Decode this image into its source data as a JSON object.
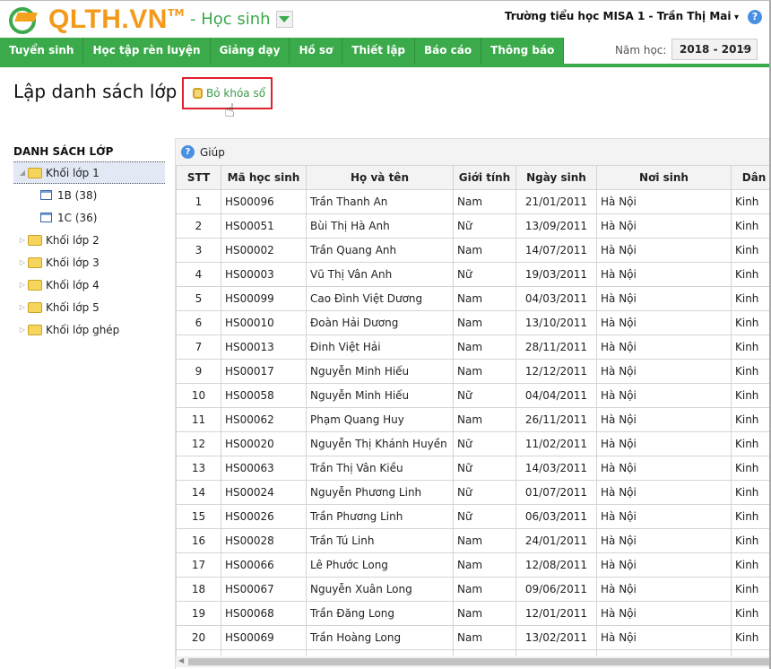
{
  "header": {
    "logo": "QLTH.VN",
    "trademark": "TM",
    "module": "- Học sinh",
    "user": "Trường tiểu học MISA 1 - Trần Thị Mai",
    "help_icon": "?"
  },
  "nav": [
    "Tuyển sinh",
    "Học tập rèn luyện",
    "Giảng dạy",
    "Hồ sơ",
    "Thiết lập",
    "Báo cáo",
    "Thông báo"
  ],
  "year": {
    "label": "Năm học:",
    "value": "2018 - 2019"
  },
  "page": {
    "title": "Lập danh sách lớp",
    "unlock_button": "Bỏ khóa sổ"
  },
  "tree": {
    "title": "DANH SÁCH LỚP",
    "items": [
      {
        "label": "Khối lớp 1",
        "type": "folder",
        "expanded": true,
        "selected": true,
        "level": 0
      },
      {
        "label": "1B (38)",
        "type": "class",
        "level": 1
      },
      {
        "label": "1C (36)",
        "type": "class",
        "level": 1
      },
      {
        "label": "Khối lớp 2",
        "type": "folder",
        "level": 0
      },
      {
        "label": "Khối lớp 3",
        "type": "folder",
        "level": 0
      },
      {
        "label": "Khối lớp 4",
        "type": "folder",
        "level": 0
      },
      {
        "label": "Khối lớp 5",
        "type": "folder",
        "level": 0
      },
      {
        "label": "Khối lớp ghép",
        "type": "folder",
        "level": 0
      }
    ]
  },
  "toolbar": {
    "help": "Giúp"
  },
  "table": {
    "columns": [
      "STT",
      "Mã học sinh",
      "Họ và tên",
      "Giới tính",
      "Ngày sinh",
      "Nơi sinh",
      "Dân t"
    ],
    "rows": [
      [
        "1",
        "HS00096",
        "Trần Thanh An",
        "Nam",
        "21/01/2011",
        "Hà Nội",
        "Kinh"
      ],
      [
        "2",
        "HS00051",
        "Bùi Thị Hà Anh",
        "Nữ",
        "13/09/2011",
        "Hà Nội",
        "Kinh"
      ],
      [
        "3",
        "HS00002",
        "Trần Quang Anh",
        "Nam",
        "14/07/2011",
        "Hà Nội",
        "Kinh"
      ],
      [
        "4",
        "HS00003",
        "Vũ Thị Vân Anh",
        "Nữ",
        "19/03/2011",
        "Hà Nội",
        "Kinh"
      ],
      [
        "5",
        "HS00099",
        "Cao Đình Việt Dương",
        "Nam",
        "04/03/2011",
        "Hà Nội",
        "Kinh"
      ],
      [
        "6",
        "HS00010",
        "Đoàn Hải Dương",
        "Nam",
        "13/10/2011",
        "Hà Nội",
        "Kinh"
      ],
      [
        "7",
        "HS00013",
        "Đinh Việt Hải",
        "Nam",
        "28/11/2011",
        "Hà Nội",
        "Kinh"
      ],
      [
        "9",
        "HS00017",
        "Nguyễn Minh Hiếu",
        "Nam",
        "12/12/2011",
        "Hà Nội",
        "Kinh"
      ],
      [
        "10",
        "HS00058",
        "Nguyễn Minh Hiếu",
        "Nữ",
        "04/04/2011",
        "Hà Nội",
        "Kinh"
      ],
      [
        "11",
        "HS00062",
        "Phạm Quang Huy",
        "Nam",
        "26/11/2011",
        "Hà Nội",
        "Kinh"
      ],
      [
        "12",
        "HS00020",
        "Nguyễn Thị Khánh Huyền",
        "Nữ",
        "11/02/2011",
        "Hà Nội",
        "Kinh"
      ],
      [
        "13",
        "HS00063",
        "Trần Thị Vân Kiều",
        "Nữ",
        "14/03/2011",
        "Hà Nội",
        "Kinh"
      ],
      [
        "14",
        "HS00024",
        "Nguyễn Phương Linh",
        "Nữ",
        "01/07/2011",
        "Hà Nội",
        "Kinh"
      ],
      [
        "15",
        "HS00026",
        "Trần Phương Linh",
        "Nữ",
        "06/03/2011",
        "Hà Nội",
        "Kinh"
      ],
      [
        "16",
        "HS00028",
        "Trần Tú Linh",
        "Nam",
        "24/01/2011",
        "Hà Nội",
        "Kinh"
      ],
      [
        "17",
        "HS00066",
        "Lê Phước Long",
        "Nam",
        "12/08/2011",
        "Hà Nội",
        "Kinh"
      ],
      [
        "18",
        "HS00067",
        "Nguyễn Xuân Long",
        "Nam",
        "09/06/2011",
        "Hà Nội",
        "Kinh"
      ],
      [
        "19",
        "HS00068",
        "Trần Đăng Long",
        "Nam",
        "12/01/2011",
        "Hà Nội",
        "Kinh"
      ],
      [
        "20",
        "HS00069",
        "Trần Hoàng Long",
        "Nam",
        "13/02/2011",
        "Hà Nội",
        "Kinh"
      ],
      [
        "",
        "",
        "",
        "",
        "",
        "",
        ""
      ]
    ]
  },
  "colors": {
    "brand_green": "#3aaa4a",
    "logo_orange": "#f39a1b",
    "highlight_red": "#e0202a"
  }
}
